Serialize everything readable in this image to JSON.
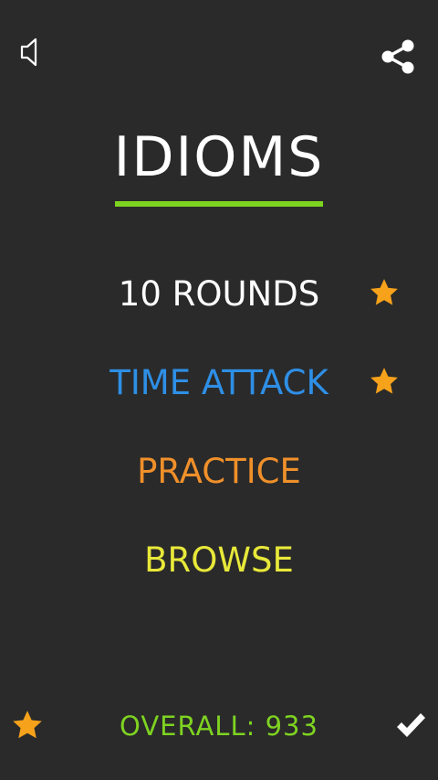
{
  "header": {
    "title": "IDIOMS",
    "sound_icon": "speaker-icon",
    "share_icon": "share-icon",
    "underline_color": "#7ed321"
  },
  "menu": {
    "items": [
      {
        "label": "10 ROUNDS",
        "color": "#ffffff",
        "starred": true
      },
      {
        "label": "TIME ATTACK",
        "color": "#2e8fe6",
        "starred": true
      },
      {
        "label": "PRACTICE",
        "color": "#f0902a",
        "starred": false
      },
      {
        "label": "BROWSE",
        "color": "#e8e83a",
        "starred": false
      }
    ],
    "star_color": "#f7a21b"
  },
  "footer": {
    "overall": "OVERALL: 933",
    "overall_color": "#7ed321",
    "star_icon": "star-icon",
    "check_icon": "checkmark-icon"
  },
  "colors": {
    "background": "#2a2a2a"
  }
}
